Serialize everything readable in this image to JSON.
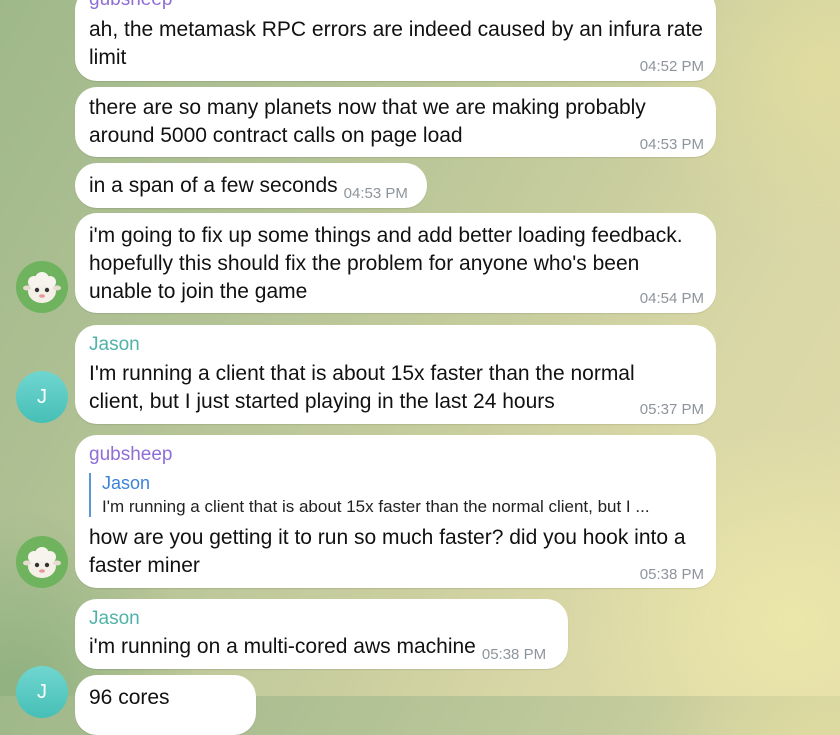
{
  "messages": [
    {
      "sender": "gubsheep",
      "text": "ah, the metamask RPC errors are indeed caused by an infura rate\nlimit",
      "time": "04:52 PM"
    },
    {
      "text": "there are so many planets now that we are making probably\naround 5000 contract calls on page load",
      "time": "04:53 PM"
    },
    {
      "text": "in a span of a few seconds",
      "time": "04:53 PM"
    },
    {
      "text": "i'm going to fix up some things and add better loading feedback.\nhopefully this should fix the problem for anyone who's been\nunable to join the game",
      "time": "04:54 PM"
    },
    {
      "sender": "Jason",
      "text": "I'm running a client that is about 15x faster than the normal\nclient, but I just started playing in the last 24 hours",
      "time": "05:37 PM"
    },
    {
      "sender": "gubsheep",
      "reply_name": "Jason",
      "reply_text": "I'm running a client that is about 15x faster than the normal client, but I ...",
      "text": "how are you getting it to run so much faster? did you hook into a\nfaster miner",
      "time": "05:38 PM"
    },
    {
      "sender": "Jason",
      "text": "i'm running on a multi-cored aws machine",
      "time": "05:38 PM"
    },
    {
      "text": "96 cores"
    }
  ],
  "avatars": {
    "gubsheep": "sheep-icon",
    "jason_initial": "J"
  },
  "colors": {
    "gubsheep_name": "#8f6ed5",
    "jason_name": "#4fb3a8",
    "reply_bar": "#5b96d8",
    "timestamp": "#8e949b"
  }
}
